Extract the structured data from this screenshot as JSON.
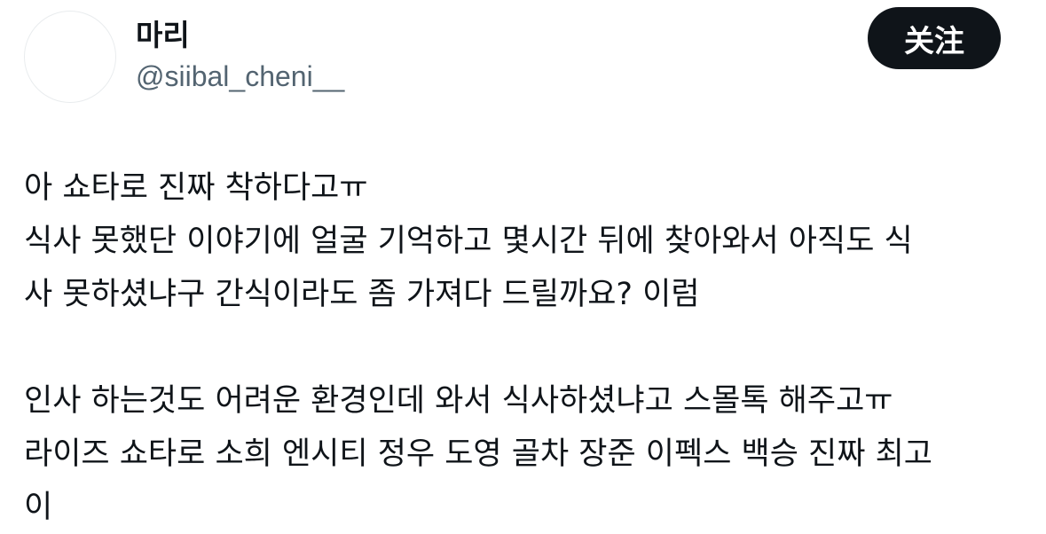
{
  "profile": {
    "display_name": "마리",
    "handle": "@siibal_cheni__"
  },
  "follow_button": {
    "label": "关注"
  },
  "tweet": {
    "lines": [
      "아 쇼타로 진짜 착하다고ㅠ",
      "식사 못했단 이야기에 얼굴 기억하고 몇시간 뒤에 찾아와서 아직도 식",
      "사 못하셨냐구 간식이라도 좀 가져다 드릴까요? 이럼",
      "",
      "인사 하는것도 어려운 환경인데 와서 식사하셨냐고 스몰톡 해주고ㅠ",
      "라이즈 쇼타로 소희 엔시티 정우 도영 골차 장준 이펙스 백승 진짜 최고",
      "이"
    ]
  }
}
